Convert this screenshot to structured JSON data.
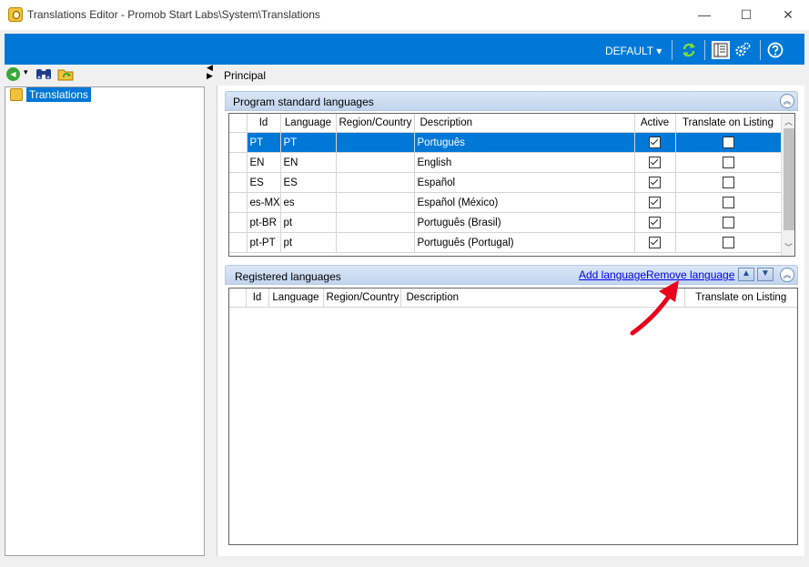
{
  "window": {
    "title": "Translations Editor - Promob Start Labs\\System\\Translations",
    "minimize_glyph": "—",
    "maximize_glyph": "☐",
    "close_glyph": "✕"
  },
  "toolbar": {
    "profile_label": "DEFAULT ▾",
    "icons": [
      "refresh-icon",
      "columns-icon",
      "settings-gears-icon",
      "help-icon"
    ]
  },
  "nav": {
    "back_glyph": "◀",
    "dropdown_glyph": "▾"
  },
  "tree": {
    "root_label": "Translations"
  },
  "splitter": {
    "left_glyph": "◀",
    "right_glyph": "▶"
  },
  "main": {
    "title": "Principal"
  },
  "standard": {
    "title": "Program standard languages",
    "collapse_glyph": "︽",
    "columns": [
      "Id",
      "Language",
      "Region/Country",
      "Description",
      "Active",
      "Translate on Listing"
    ],
    "rows": [
      {
        "id": "PT",
        "language": "PT",
        "region": "",
        "description": "Português",
        "active": true,
        "translate": false,
        "selected": true
      },
      {
        "id": "EN",
        "language": "EN",
        "region": "",
        "description": "English",
        "active": true,
        "translate": false,
        "selected": false
      },
      {
        "id": "ES",
        "language": "ES",
        "region": "",
        "description": "Español",
        "active": true,
        "translate": false,
        "selected": false
      },
      {
        "id": "es-MX",
        "language": "es",
        "region": "",
        "description": "Español (México)",
        "active": true,
        "translate": false,
        "selected": false
      },
      {
        "id": "pt-BR",
        "language": "pt",
        "region": "",
        "description": "Português (Brasil)",
        "active": true,
        "translate": false,
        "selected": false
      },
      {
        "id": "pt-PT",
        "language": "pt",
        "region": "",
        "description": "Português (Portugal)",
        "active": true,
        "translate": false,
        "selected": false
      }
    ]
  },
  "registered": {
    "title": "Registered languages",
    "add_link": "Add language",
    "remove_link": "Remove language",
    "up_glyph": "▲",
    "down_glyph": "▼",
    "collapse_glyph": "︽",
    "columns": [
      "Id",
      "Language",
      "Region/Country",
      "Description",
      "Translate on Listing"
    ]
  },
  "colors": {
    "accent": "#0078d7",
    "annotation_arrow": "#e8001c"
  }
}
